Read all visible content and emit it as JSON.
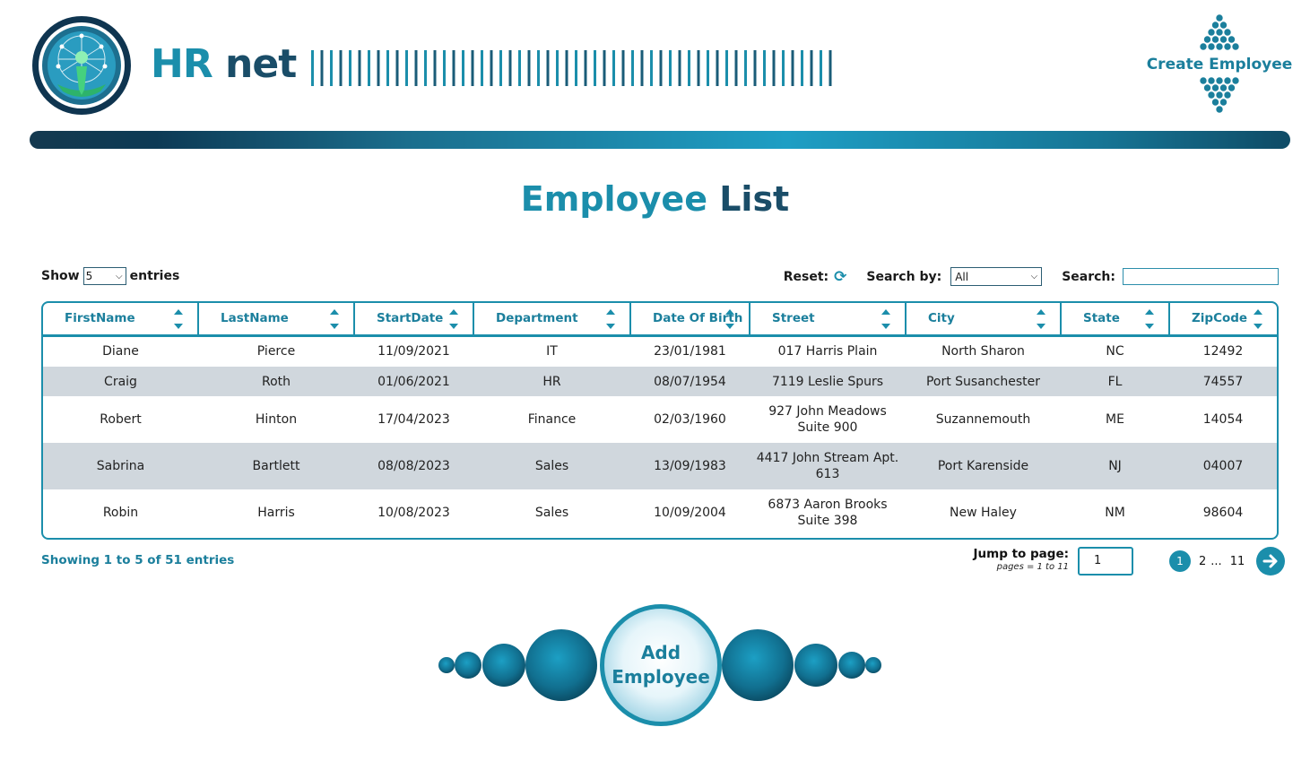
{
  "brand": {
    "hr": "HR",
    "net": "net"
  },
  "header": {
    "create_label": "Create Employee"
  },
  "title": {
    "part1": "Employee",
    "part2": "List"
  },
  "controls": {
    "show_label": "Show",
    "show_value": "5",
    "entries_label": "entries",
    "reset_label": "Reset:",
    "search_by_label": "Search by:",
    "search_by_value": "All",
    "search_label": "Search:",
    "search_value": ""
  },
  "table": {
    "columns": [
      "FirstName",
      "LastName",
      "StartDate",
      "Department",
      "Date Of Birth",
      "Street",
      "City",
      "State",
      "ZipCode"
    ],
    "rows": [
      {
        "first": "Diane",
        "last": "Pierce",
        "start": "11/09/2021",
        "dept": "IT",
        "dob": "23/01/1981",
        "street1": "017 Harris Plain",
        "street2": "",
        "city": "North Sharon",
        "state": "NC",
        "zip": "12492"
      },
      {
        "first": "Craig",
        "last": "Roth",
        "start": "01/06/2021",
        "dept": "HR",
        "dob": "08/07/1954",
        "street1": "7119 Leslie Spurs",
        "street2": "",
        "city": "Port Susanchester",
        "state": "FL",
        "zip": "74557"
      },
      {
        "first": "Robert",
        "last": "Hinton",
        "start": "17/04/2023",
        "dept": "Finance",
        "dob": "02/03/1960",
        "street1": "927 John Meadows",
        "street2": "Suite 900",
        "city": "Suzannemouth",
        "state": "ME",
        "zip": "14054"
      },
      {
        "first": "Sabrina",
        "last": "Bartlett",
        "start": "08/08/2023",
        "dept": "Sales",
        "dob": "13/09/1983",
        "street1": "4417 John Stream Apt.",
        "street2": "613",
        "city": "Port Karenside",
        "state": "NJ",
        "zip": "04007"
      },
      {
        "first": "Robin",
        "last": "Harris",
        "start": "10/08/2023",
        "dept": "Sales",
        "dob": "10/09/2004",
        "street1": "6873 Aaron Brooks",
        "street2": "Suite 398",
        "city": "New Haley",
        "state": "NM",
        "zip": "98604"
      }
    ]
  },
  "footer": {
    "showing": "Showing 1 to 5 of 51 entries",
    "jump_label": "Jump to page:",
    "jump_hint": "pages = 1 to 11",
    "jump_value": "1",
    "pages": {
      "current": "1",
      "next": "2",
      "ellipsis": "...",
      "last": "11"
    }
  },
  "add_button": {
    "line1": "Add",
    "line2": "Employee"
  },
  "colors": {
    "accent": "#1b8eab",
    "dark": "#1a4d68",
    "row_alt": "#d0d7dd"
  }
}
